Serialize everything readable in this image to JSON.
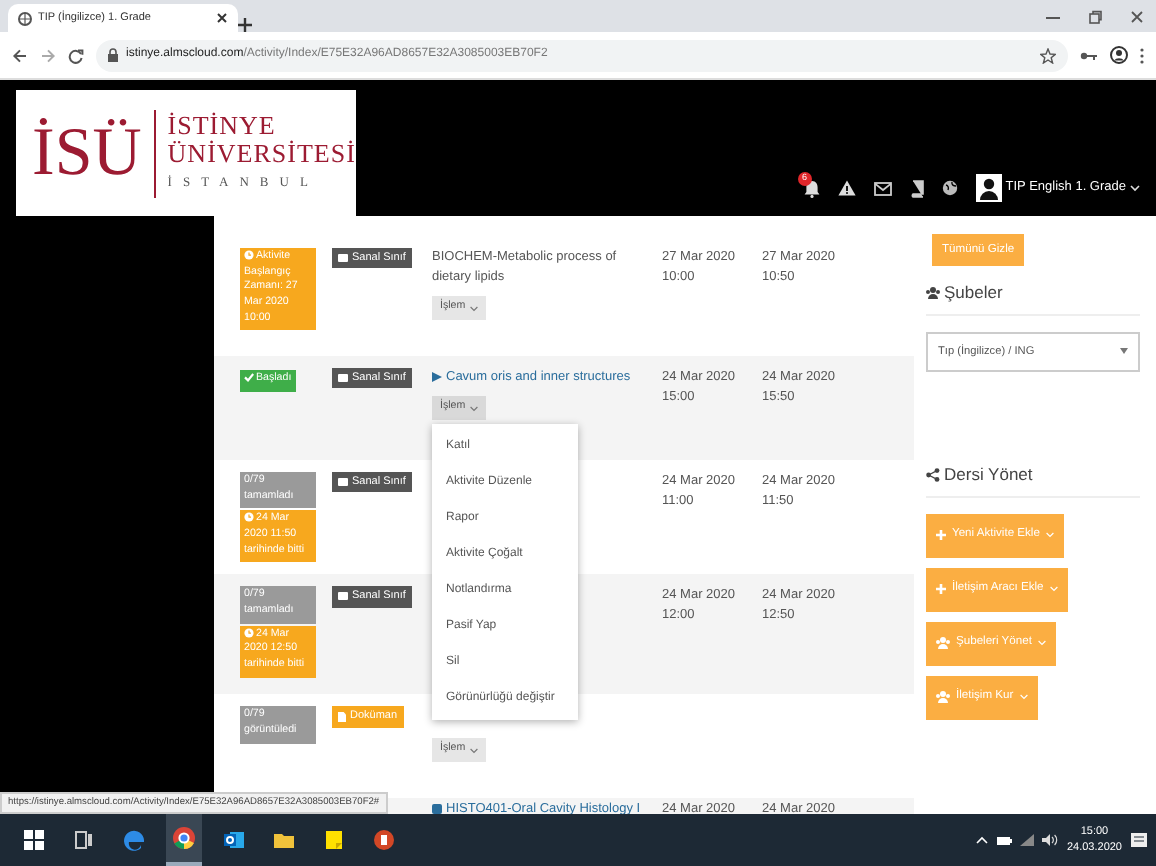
{
  "browser": {
    "tab_title": "TIP (İngilizce) 1. Grade",
    "url_host": "istinye.almscloud.com",
    "url_path": "/Activity/Index/E75E32A96AD8657E32A3085003EB70F2",
    "status_url": "https://istinye.almscloud.com/Activity/Index/E75E32A96AD8657E32A3085003EB70F2#"
  },
  "logo": {
    "mark": "İSÜ",
    "line1": "İSTİNYE",
    "line2": "ÜNİVERSİTESİ",
    "city": "İSTANBUL"
  },
  "header": {
    "notification_count": "6",
    "user": "TIP English 1. Grade"
  },
  "activities": [
    {
      "badges": [
        {
          "kind": "scheduled",
          "text": "Aktivite Başlangıç Zamanı: 27 Mar 2020 10:00"
        }
      ],
      "type": {
        "kind": "virtual",
        "label": "Sanal Sınıf"
      },
      "title": "BIOCHEM-Metabolic process of dietary lipids",
      "link": false,
      "start_date": "27 Mar 2020",
      "start_time": "10:00",
      "end_date": "27 Mar 2020",
      "end_time": "10:50",
      "action": "İşlem",
      "menu_open": false
    },
    {
      "badges": [
        {
          "kind": "started",
          "text": "Başladı"
        }
      ],
      "type": {
        "kind": "virtual",
        "label": "Sanal Sınıf"
      },
      "title": "Cavum oris and inner structures",
      "link": true,
      "start_date": "24 Mar 2020",
      "start_time": "15:00",
      "end_date": "24 Mar 2020",
      "end_time": "15:50",
      "action": "İşlem",
      "menu_open": true
    },
    {
      "badges": [
        {
          "kind": "completed",
          "text": "0/79 tamamladı"
        },
        {
          "kind": "ended",
          "text": "24 Mar 2020 11:50 tarihinde bitti"
        }
      ],
      "type": {
        "kind": "virtual",
        "label": "Sanal Sınıf"
      },
      "start_date": "24 Mar 2020",
      "start_time": "11:00",
      "end_date": "24 Mar 2020",
      "end_time": "11:50"
    },
    {
      "badges": [
        {
          "kind": "completed",
          "text": "0/79 tamamladı"
        },
        {
          "kind": "ended",
          "text": "24 Mar 2020 12:50 tarihinde bitti"
        }
      ],
      "type": {
        "kind": "virtual",
        "label": "Sanal Sınıf"
      },
      "start_date": "24 Mar 2020",
      "start_time": "12:00",
      "end_date": "24 Mar 2020",
      "end_time": "12:50"
    },
    {
      "badges": [
        {
          "kind": "completed",
          "text": "0/79 görüntüledi"
        }
      ],
      "type": {
        "kind": "document",
        "label": "Doküman"
      },
      "action": "İşlem",
      "menu_open": false
    },
    {
      "title": "HISTO401-Oral Cavity Histology I",
      "link": true,
      "start_date": "24 Mar 2020",
      "end_date": "24 Mar 2020"
    }
  ],
  "action_menu": [
    "Katıl",
    "Aktivite Düzenle",
    "Rapor",
    "Aktivite Çoğalt",
    "Notlandırma",
    "Pasif Yap",
    "Sil",
    "Görünürlüğü değiştir"
  ],
  "sidebar": {
    "hide_all": "Tümünü Gizle",
    "branches_heading": "Şubeler",
    "branch_select": "Tıp (İngilizce) / ING",
    "manage_heading": "Dersi Yönet",
    "buttons": [
      {
        "kind": "add",
        "label": "Yeni Aktivite Ekle"
      },
      {
        "kind": "add",
        "label": "İletişim Aracı Ekle"
      },
      {
        "kind": "group",
        "label": "Şubeleri Yönet"
      },
      {
        "kind": "group",
        "label": "İletişim Kur"
      }
    ]
  },
  "taskbar": {
    "time": "15:00",
    "date": "24.03.2020"
  }
}
